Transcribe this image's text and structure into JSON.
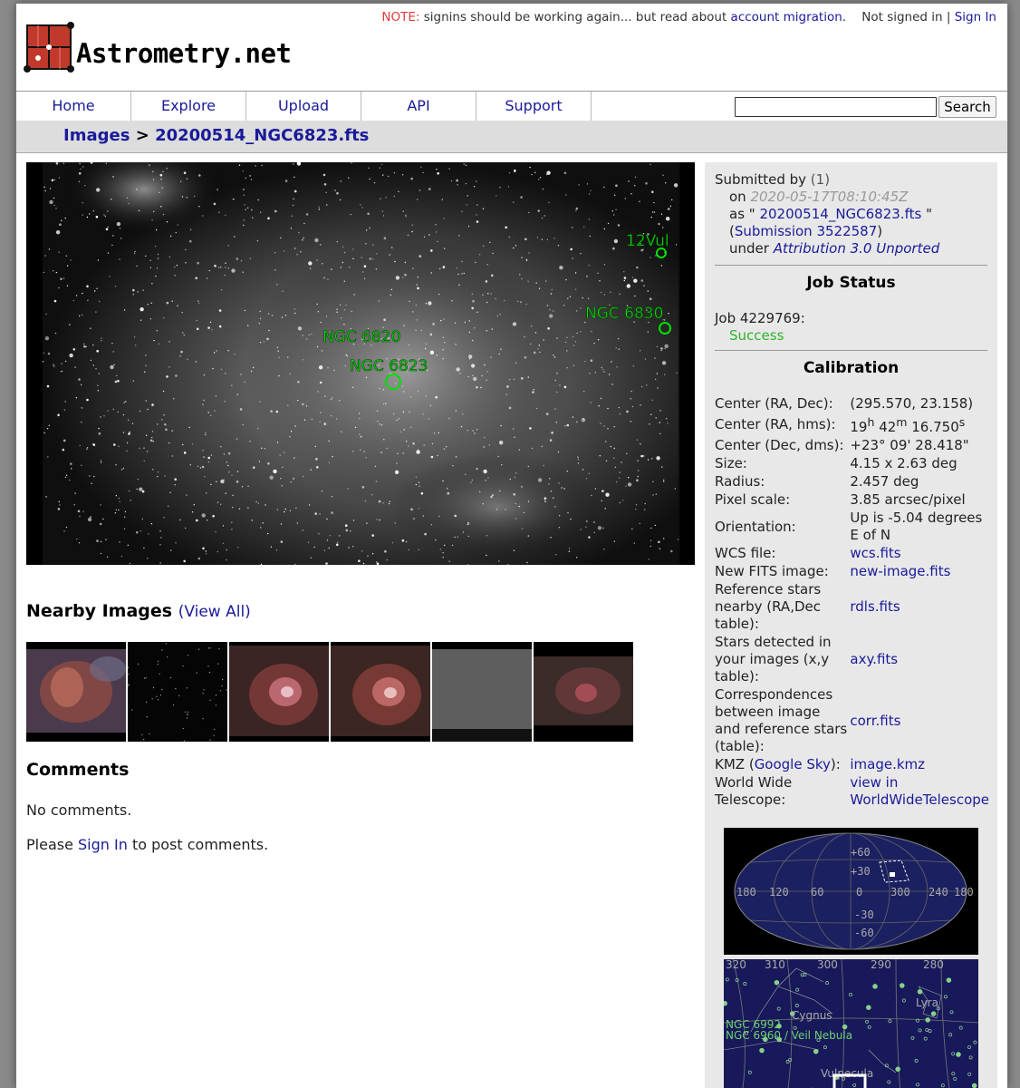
{
  "header": {
    "logo_text": "Astrometry.net",
    "notice_label": "NOTE:",
    "notice_text": " signins should be working again... but read about ",
    "notice_link": "account migration",
    "notice_end": ".",
    "signin_status": "Not signed in |",
    "signin_link": "Sign In"
  },
  "nav": {
    "items": [
      "Home",
      "Explore",
      "Upload",
      "API",
      "Support"
    ],
    "search_value": "",
    "search_button": "Search"
  },
  "breadcrumb": {
    "root": "Images",
    "separator": ">",
    "current": "20200514_NGC6823.fts"
  },
  "image": {
    "annotations": [
      "12Vul",
      "NGC 6830",
      "NGC 6820",
      "NGC 6823"
    ],
    "colors": {
      "annotation": "#00e000"
    }
  },
  "nearby": {
    "title": "Nearby Images",
    "open_paren": "(",
    "view_all": "View All",
    "close_paren": ")",
    "thumb_count": 6
  },
  "comments": {
    "title": "Comments",
    "none": "No comments.",
    "prompt_pre": "Please",
    "prompt_link": "Sign In",
    "prompt_post": "to post comments."
  },
  "submission": {
    "submitted_by_label": "Submitted by",
    "submitted_by": "(1)",
    "on_label": "on",
    "timestamp": "2020-05-17T08:10:45Z",
    "as_label": "as \"",
    "filename": "20200514_NGC6823.fts",
    "as_end": "\"",
    "submission_link": "Submission 3522587",
    "under_label": "under",
    "license": "Attribution 3.0 Unported"
  },
  "job": {
    "heading": "Job Status",
    "id_label": "Job 4229769:",
    "status": "Success"
  },
  "calibration": {
    "heading": "Calibration",
    "center_radec_label": "Center (RA, Dec):",
    "center_radec": "(295.570, 23.158)",
    "center_hms_label": "Center (RA, hms):",
    "ra_h": "19",
    "ra_h_unit": "h",
    "ra_m": "42",
    "ra_m_unit": "m",
    "ra_s": "16.750",
    "ra_s_unit": "s",
    "center_dms_label": "Center (Dec, dms):",
    "center_dms": "+23° 09' 28.418\"",
    "size_label": "Size:",
    "size": "4.15 x 2.63 deg",
    "radius_label": "Radius:",
    "radius": "2.457 deg",
    "pixel_scale_label": "Pixel scale:",
    "pixel_scale": "3.85 arcsec/pixel",
    "orientation_label": "Orientation:",
    "orientation": "Up is -5.04 degrees E of N",
    "wcs_label": "WCS file:",
    "wcs": "wcs.fits",
    "newfits_label": "New FITS image:",
    "newfits": "new-image.fits",
    "rdls_label": "Reference stars nearby (RA,Dec table):",
    "rdls": "rdls.fits",
    "axy_label": "Stars detected in your images (x,y table):",
    "axy": "axy.fits",
    "corr_label": "Correspondences between image and reference stars (table):",
    "corr": "corr.fits",
    "kmz_label_pre": "KMZ (",
    "kmz_label_link": "Google Sky",
    "kmz_label_post": "):",
    "kmz": "image.kmz",
    "wwt_label": "World Wide Telescope:",
    "wwt": "view in WorldWideTelescope"
  },
  "skymap": {
    "ra_ticks": [
      "180",
      "120",
      "60",
      "0",
      "300",
      "240",
      "180"
    ],
    "dec_ticks": [
      "+60",
      "+30",
      "-30",
      "-60"
    ]
  },
  "zoom_map": {
    "ra_ticks": [
      "320",
      "310",
      "300",
      "290",
      "280"
    ],
    "labels": [
      "Cygnus",
      "Lyra",
      "NGC 6992",
      "NGC 6960 / Veil Nebula",
      "Vulpecula"
    ]
  }
}
